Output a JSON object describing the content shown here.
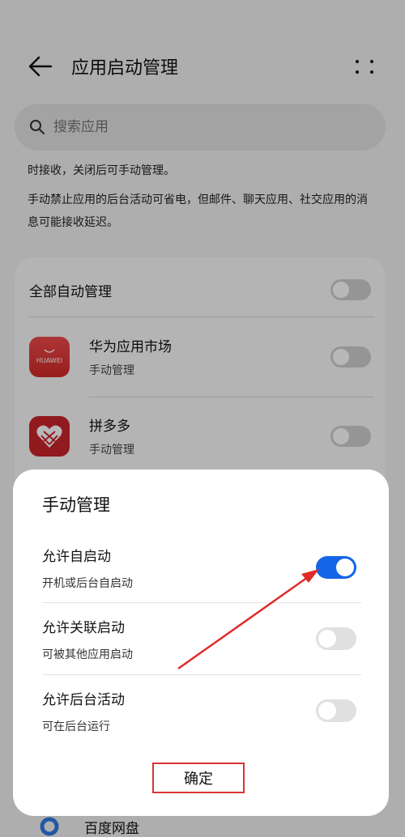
{
  "header": {
    "title": "应用启动管理"
  },
  "search": {
    "placeholder": "搜索应用"
  },
  "description": {
    "line1": "时接收，关闭后可手动管理。",
    "line2": "手动禁止应用的后台活动可省电，但邮件、聊天应用、社交应用的消息可能接收延迟。"
  },
  "list": {
    "all_label": "全部自动管理",
    "apps": [
      {
        "name": "华为应用市场",
        "status": "手动管理",
        "icon_text": "HUAWEI"
      },
      {
        "name": "拼多多",
        "status": "手动管理"
      }
    ],
    "peek_app": "百度网盘"
  },
  "dialog": {
    "title": "手动管理",
    "options": [
      {
        "label": "允许自启动",
        "sub": "开机或后台自启动",
        "on": true
      },
      {
        "label": "允许关联启动",
        "sub": "可被其他应用启动",
        "on": false
      },
      {
        "label": "允许后台活动",
        "sub": "可在后台运行",
        "on": false
      }
    ],
    "confirm": "确定"
  },
  "colors": {
    "accent": "#1465e8",
    "annotation": "#d93434",
    "huawei_red": "#e23a3a",
    "pdd_red": "#c9252b"
  }
}
